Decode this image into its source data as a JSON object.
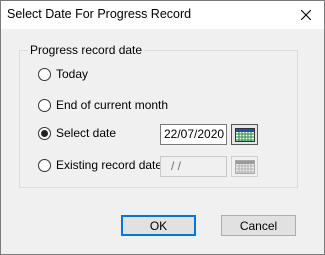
{
  "window": {
    "title": "Select Date For Progress Record"
  },
  "group": {
    "legend": "Progress record date"
  },
  "options": [
    {
      "label": "Today",
      "selected": false
    },
    {
      "label": "End of current month",
      "selected": false
    },
    {
      "label": "Select date",
      "selected": true
    },
    {
      "label": "Existing record date",
      "selected": false
    }
  ],
  "select_date": {
    "value": "22/07/2020"
  },
  "existing_date": {
    "value": "/ /",
    "enabled": false
  },
  "buttons": {
    "ok": "OK",
    "cancel": "Cancel"
  },
  "icons": {
    "close": "close-icon",
    "calendar": "calendar-icon"
  },
  "colors": {
    "accent": "#0078d7",
    "title_bg": "#ffffff",
    "dialog_bg": "#f0f0f0"
  }
}
